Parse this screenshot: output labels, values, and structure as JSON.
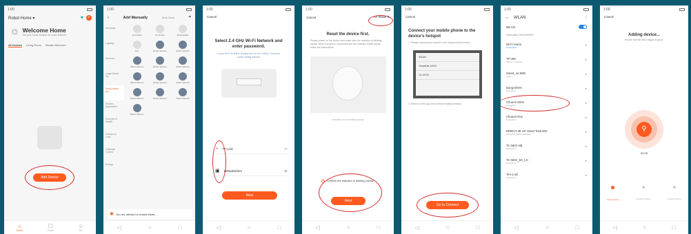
{
  "status": {
    "time": "1:00",
    "icons": "▪▪▪"
  },
  "screen1": {
    "app_name": "Robot Home",
    "welcome": "Welcome Home",
    "subtitle": "Set your home location for more features",
    "rooms": [
      "All Devices",
      "Living Room",
      "Master Bedroom"
    ],
    "add_button": "Add Device",
    "nav": [
      "Home",
      "Smart",
      "Me"
    ]
  },
  "screen2": {
    "title": "Add Manually",
    "auto_scan": "Auto Scan",
    "categories": [
      "Electrical",
      "Lighting",
      "Sensors",
      "Large Home Ap.",
      "Small Home Ap.",
      "Kitchen Appliances",
      "Exercise & Health",
      "Camera & Lock",
      "Gateway Control",
      "Energy"
    ],
    "devices": [
      "Air Purifier",
      "Air Purifier",
      "Dehumidifier",
      "Fan",
      "Robot Vacuum",
      "Robot Vacuum",
      "Robot Vacuum",
      "Robot Vacuum",
      "Robot Vacuum",
      "Robot Vacuum",
      "Robot Vacuum",
      "Robot Vacuum",
      "Robot Vacuum",
      "Robot Vacuum",
      "Robot Vacuum",
      "Robot Vacuum"
    ],
    "banner": "You are advised to enable Bluet..."
  },
  "screen3": {
    "cancel": "Cancel",
    "title": "Select 2.4 GHz Wi-Fi Network and enter password.",
    "note": "If your Wi-Fi is 5GHz, please set it to be 2.4GHz. Common router setting method",
    "wifi_name": "TP-Link",
    "password": "H#8u&Wi321",
    "next": "Next"
  },
  "screen4": {
    "cancel": "Cancel",
    "mode": "AP Mode",
    "title": "Reset the device first.",
    "desc": "Please power on the device and make sure the indicator is blinking slowly. When connect is successful and the indicator blinks slowly, follow the instructions.",
    "blink_help": "Indicator is not blinking slowly",
    "confirm": "Confirm the indicator is blinking slowly",
    "next": "Next"
  },
  "screen5": {
    "cancel": "Cancel",
    "title": "Connect your mobile phone to the device's hotspot",
    "steps": "1. Please connect your phone to the hotspot shown below",
    "wifi_rows": [
      "WLAN",
      "SmartLife-XXXX",
      "SL-XXXX"
    ],
    "step2": "2. Return to this app and continue adding devices.",
    "go_connect": "Go to Connect"
  },
  "screen6": {
    "back": "WLAN",
    "wlan_label": "WLAN",
    "section": "AVAILABLE NETWORKS",
    "networks": [
      {
        "name": "Wi-Fi Home",
        "sub": "Connected"
      },
      {
        "name": "TP-480",
        "sub": "Saved, encrypted"
      },
      {
        "name": "Smart_Air-B3D",
        "sub": "Open"
      },
      {
        "name": "DungAnhHn",
        "sub": "Encrypted"
      },
      {
        "name": "ChuaAn 60Hz",
        "sub": "Encrypted"
      },
      {
        "name": "ChuaAn Rue",
        "sub": "Encrypted"
      },
      {
        "name": "DIRECT-4E HP Smart Tank 500",
        "sub": "Encrypted (WPS available)"
      },
      {
        "name": "TC-NEO-HB",
        "sub": "Encrypted"
      },
      {
        "name": "TC-NEO_5G_LH",
        "sub": "Encrypted"
      },
      {
        "name": "Tim-2.4G",
        "sub": "Encrypted"
      }
    ]
  },
  "screen7": {
    "cancel": "Cancel",
    "title": "Adding device...",
    "note": "Ensure that the Wi-Fi signal is good.",
    "percent": "00:28",
    "steps": [
      "Scan devices",
      "Register device",
      "Initialize device"
    ]
  },
  "colors": {
    "accent": "#ff5a1f",
    "circle": "#d42a2a",
    "bg": "#0d5a70"
  }
}
